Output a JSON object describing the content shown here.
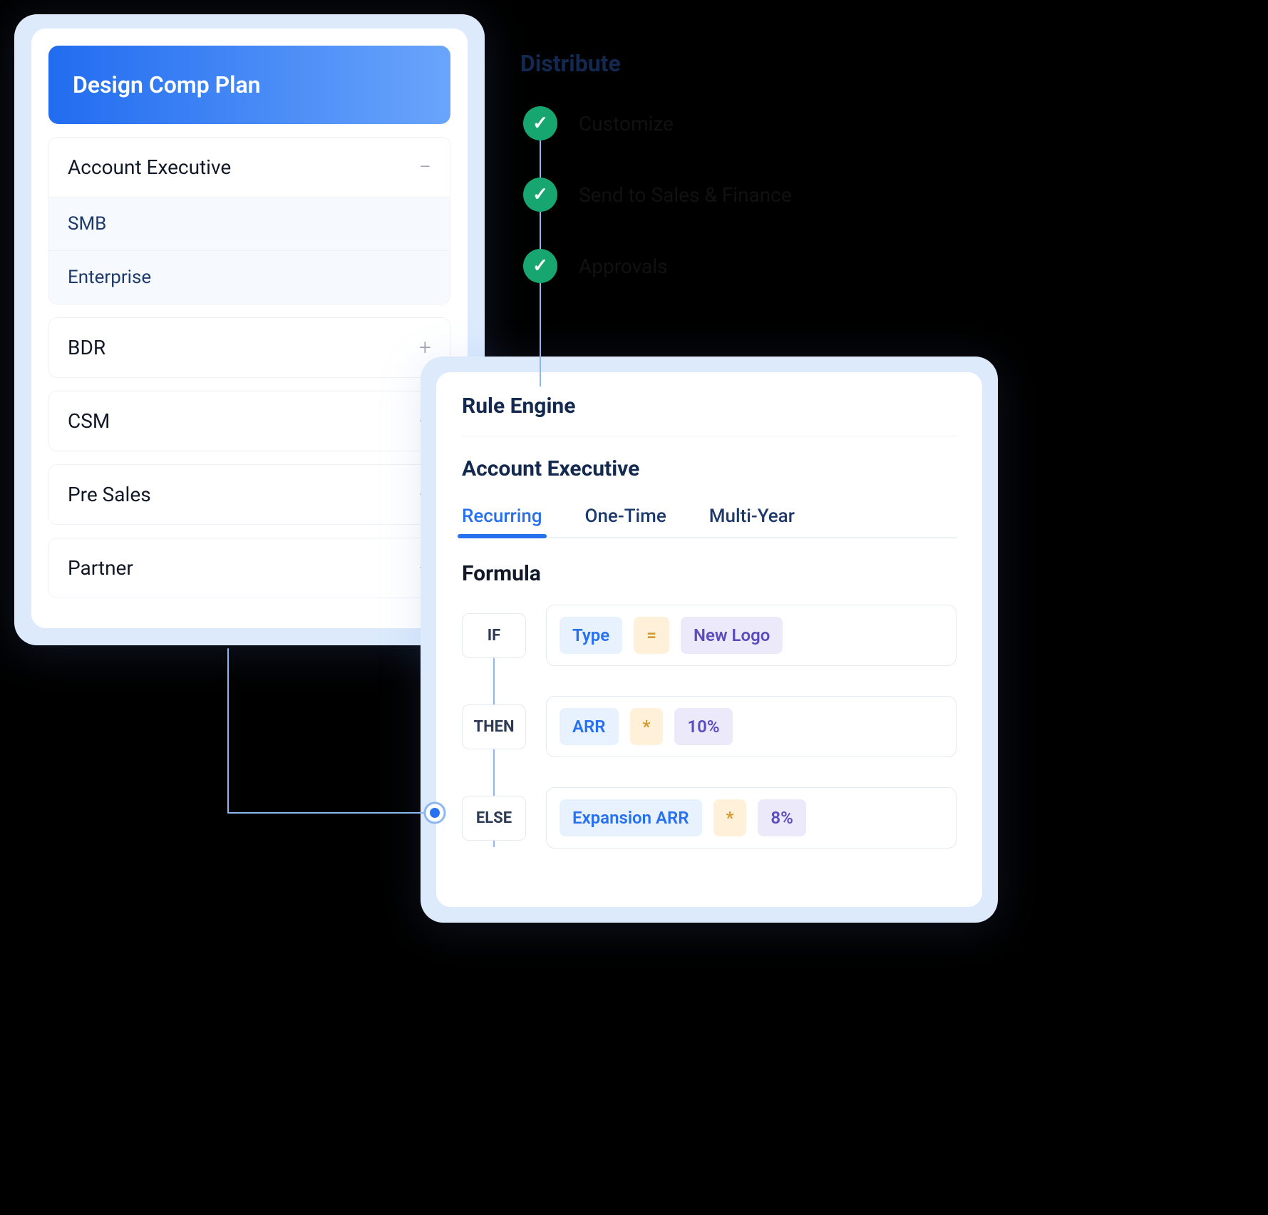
{
  "leftCard": {
    "title": "Design Comp Plan",
    "groups": [
      {
        "label": "Account Executive",
        "expanded": true,
        "items": [
          "SMB",
          "Enterprise"
        ]
      },
      {
        "label": "BDR",
        "expanded": false
      },
      {
        "label": "CSM",
        "expanded": false
      },
      {
        "label": "Pre Sales",
        "expanded": false
      },
      {
        "label": "Partner",
        "expanded": false
      }
    ]
  },
  "distribute": {
    "title": "Distribute",
    "steps": [
      "Customize",
      "Send to Sales & Finance",
      "Approvals"
    ]
  },
  "ruleEngine": {
    "title": "Rule Engine",
    "subtitle": "Account Executive",
    "tabs": [
      "Recurring",
      "One-Time",
      "Multi-Year"
    ],
    "activeTab": 0,
    "formulaTitle": "Formula",
    "rows": [
      {
        "kw": "IF",
        "chips": [
          {
            "t": "field",
            "v": "Type"
          },
          {
            "t": "op",
            "v": "="
          },
          {
            "t": "val",
            "v": "New Logo"
          }
        ]
      },
      {
        "kw": "THEN",
        "chips": [
          {
            "t": "field",
            "v": "ARR"
          },
          {
            "t": "op",
            "v": "*"
          },
          {
            "t": "val",
            "v": "10%"
          }
        ]
      },
      {
        "kw": "ELSE",
        "chips": [
          {
            "t": "field",
            "v": "Expansion ARR"
          },
          {
            "t": "op",
            "v": "*"
          },
          {
            "t": "val",
            "v": "8%"
          }
        ]
      }
    ]
  }
}
